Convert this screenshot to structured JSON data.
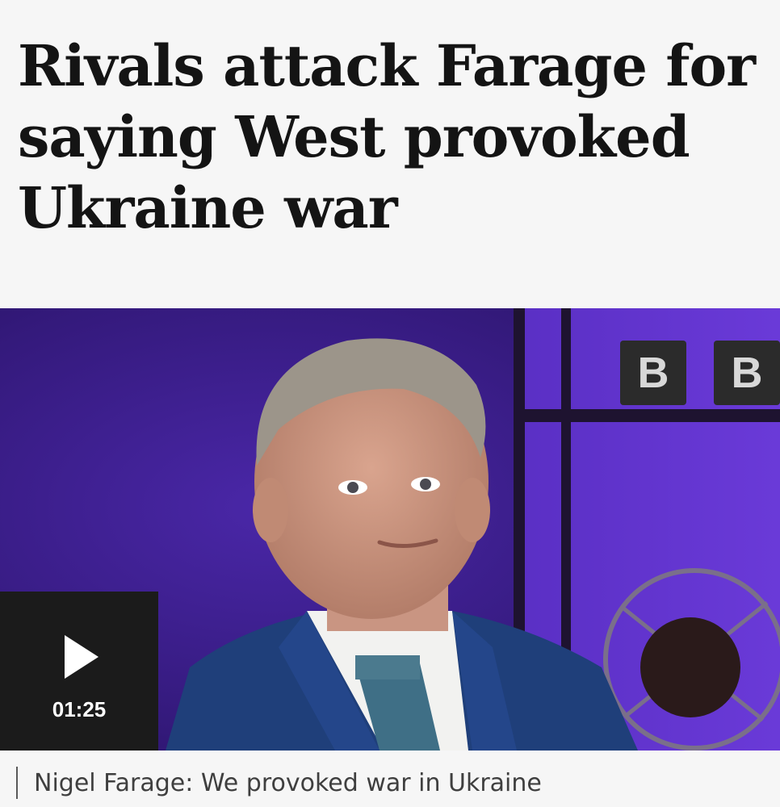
{
  "article": {
    "headline": "Rivals attack Farage for saying West provoked Ukraine war"
  },
  "video": {
    "duration": "01:25",
    "play_icon": "play-icon",
    "caption": "Nigel Farage: We provoked war in Ukraine",
    "studio_letters": [
      "B",
      "B"
    ]
  },
  "colors": {
    "page_background": "#f6f6f6",
    "headline_text": "#141414",
    "studio_purple": "#3a1c86",
    "overlay": "#1b1b1b"
  }
}
